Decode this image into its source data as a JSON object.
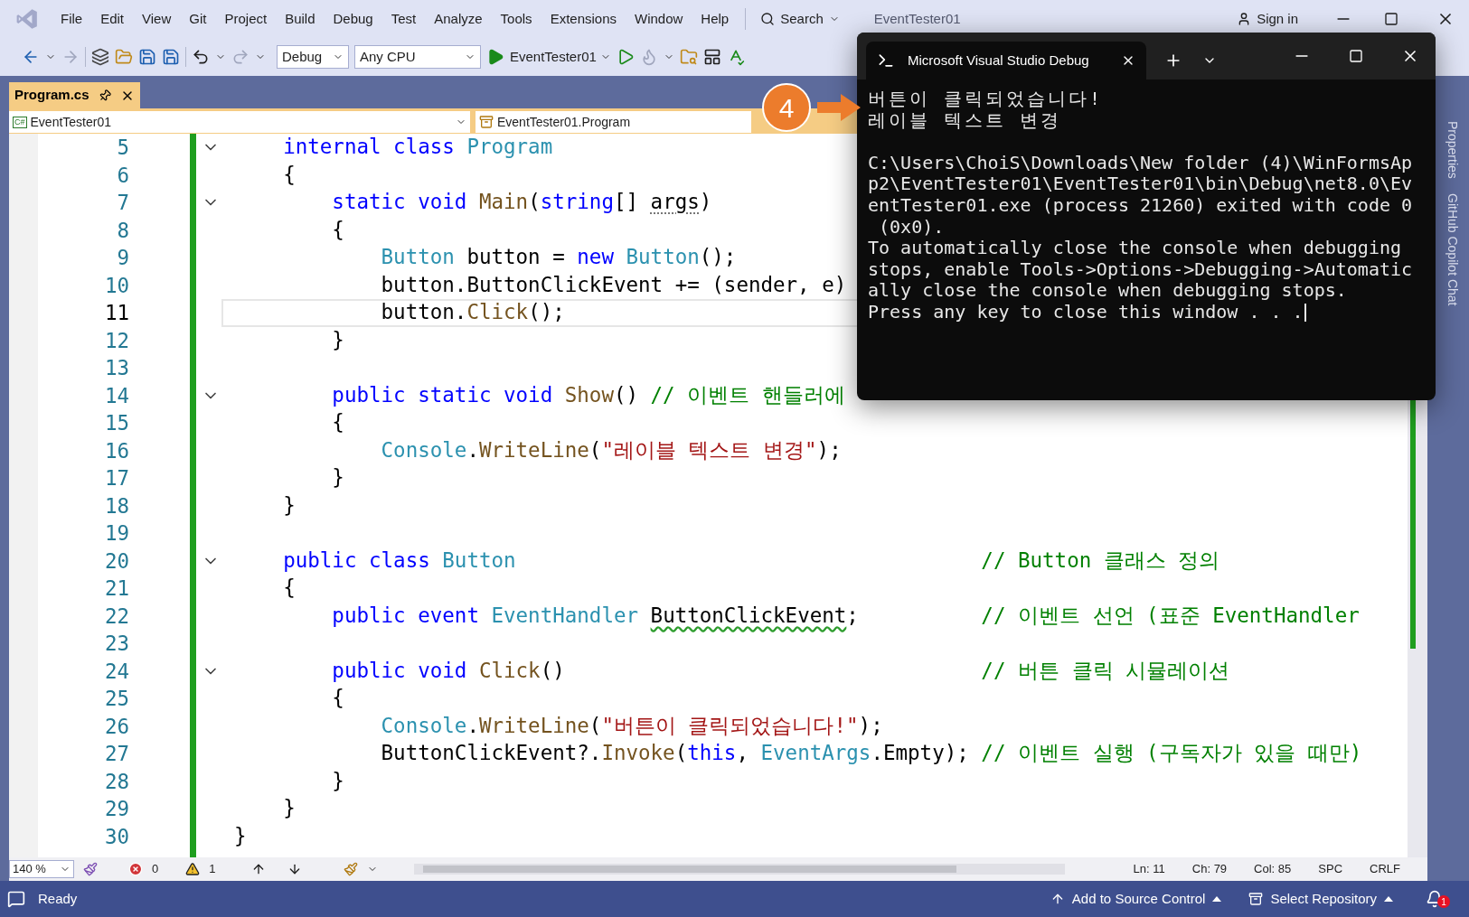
{
  "menu": [
    "File",
    "Edit",
    "View",
    "Git",
    "Project",
    "Build",
    "Debug",
    "Test",
    "Analyze",
    "Tools",
    "Extensions",
    "Window",
    "Help"
  ],
  "search": {
    "label": "Search"
  },
  "window_title": "EventTester01",
  "sign_in": "Sign in",
  "toolbar": {
    "configuration": "Debug",
    "platform": "Any CPU",
    "start_target": "EventTester01"
  },
  "document_tabs": [
    {
      "label": "Program.cs",
      "selected": true
    }
  ],
  "nav_bar": {
    "project_icon": "C#",
    "project": "EventTester01",
    "member": "EventTester01.Program"
  },
  "editor": {
    "lines": [
      {
        "number": "5",
        "foldable": true,
        "selected": false,
        "tokens": [
          {
            "kind": "kw",
            "text": "    internal class "
          },
          {
            "kind": "type",
            "text": "Program"
          }
        ]
      },
      {
        "number": "6",
        "foldable": false,
        "selected": false,
        "tokens": [
          {
            "kind": "plain",
            "text": "    {"
          }
        ]
      },
      {
        "number": "7",
        "foldable": true,
        "selected": false,
        "tokens": [
          {
            "kind": "kw",
            "text": "        static void "
          },
          {
            "kind": "method",
            "text": "Main"
          },
          {
            "kind": "plain",
            "text": "("
          },
          {
            "kind": "kw",
            "text": "string"
          },
          {
            "kind": "plain",
            "text": "[] "
          },
          {
            "kind": "plain",
            "text": "args",
            "dotted": true
          },
          {
            "kind": "plain",
            "text": ")"
          }
        ]
      },
      {
        "number": "8",
        "foldable": false,
        "selected": false,
        "tokens": [
          {
            "kind": "plain",
            "text": "        {"
          }
        ]
      },
      {
        "number": "9",
        "foldable": false,
        "selected": false,
        "tokens": [
          {
            "kind": "type",
            "text": "            Button"
          },
          {
            "kind": "plain",
            "text": " button = "
          },
          {
            "kind": "kw",
            "text": "new "
          },
          {
            "kind": "type",
            "text": "Button"
          },
          {
            "kind": "plain",
            "text": "();"
          }
        ]
      },
      {
        "number": "10",
        "foldable": false,
        "selected": false,
        "tokens": [
          {
            "kind": "plain",
            "text": "            button.ButtonClickEvent += (sender, e)"
          }
        ]
      },
      {
        "number": "11",
        "foldable": false,
        "selected": true,
        "tokens": [
          {
            "kind": "plain",
            "text": "            button."
          },
          {
            "kind": "method",
            "text": "Click"
          },
          {
            "kind": "plain",
            "text": "();"
          }
        ]
      },
      {
        "number": "12",
        "foldable": false,
        "selected": false,
        "tokens": [
          {
            "kind": "plain",
            "text": "        }"
          }
        ]
      },
      {
        "number": "13",
        "foldable": false,
        "selected": false
      },
      {
        "number": "14",
        "foldable": true,
        "selected": false,
        "tokens": [
          {
            "kind": "kw",
            "text": "        public static void "
          },
          {
            "kind": "method",
            "text": "Show"
          },
          {
            "kind": "plain",
            "text": "() "
          },
          {
            "kind": "comment",
            "text": "// 이벤트 핸들러에"
          }
        ]
      },
      {
        "number": "15",
        "foldable": false,
        "selected": false,
        "tokens": [
          {
            "kind": "plain",
            "text": "        {"
          }
        ]
      },
      {
        "number": "16",
        "foldable": false,
        "selected": false,
        "tokens": [
          {
            "kind": "type",
            "text": "            Console"
          },
          {
            "kind": "plain",
            "text": "."
          },
          {
            "kind": "method",
            "text": "WriteLine"
          },
          {
            "kind": "plain",
            "text": "("
          },
          {
            "kind": "string",
            "text": "\"레이블 텍스트 변경\""
          },
          {
            "kind": "plain",
            "text": ");"
          }
        ]
      },
      {
        "number": "17",
        "foldable": false,
        "selected": false,
        "tokens": [
          {
            "kind": "plain",
            "text": "        }"
          }
        ]
      },
      {
        "number": "18",
        "foldable": false,
        "selected": false,
        "tokens": [
          {
            "kind": "plain",
            "text": "    }"
          }
        ]
      },
      {
        "number": "19",
        "foldable": false,
        "selected": false
      },
      {
        "number": "20",
        "foldable": true,
        "selected": false,
        "tokens": [
          {
            "kind": "kw",
            "text": "    public class "
          },
          {
            "kind": "type",
            "text": "Button"
          },
          {
            "kind": "comment",
            "text": "                                      // Button 클래스 정의"
          }
        ]
      },
      {
        "number": "21",
        "foldable": false,
        "selected": false,
        "tokens": [
          {
            "kind": "plain",
            "text": "    {"
          }
        ]
      },
      {
        "number": "22",
        "foldable": false,
        "selected": false,
        "tokens": [
          {
            "kind": "kw",
            "text": "        public event "
          },
          {
            "kind": "type",
            "text": "EventHandler "
          },
          {
            "kind": "plain",
            "text": "ButtonClickEvent",
            "squiggle": true
          },
          {
            "kind": "plain",
            "text": ";"
          },
          {
            "kind": "comment",
            "text": "          // 이벤트 선언 (표준 EventHandler"
          }
        ]
      },
      {
        "number": "23",
        "foldable": false,
        "selected": false
      },
      {
        "number": "24",
        "foldable": true,
        "selected": false,
        "tokens": [
          {
            "kind": "kw",
            "text": "        public void "
          },
          {
            "kind": "method",
            "text": "Click"
          },
          {
            "kind": "plain",
            "text": "()"
          },
          {
            "kind": "comment",
            "text": "                                  // 버튼 클릭 시뮬레이션"
          }
        ]
      },
      {
        "number": "25",
        "foldable": false,
        "selected": false,
        "tokens": [
          {
            "kind": "plain",
            "text": "        {"
          }
        ]
      },
      {
        "number": "26",
        "foldable": false,
        "selected": false,
        "tokens": [
          {
            "kind": "type",
            "text": "            Console"
          },
          {
            "kind": "plain",
            "text": "."
          },
          {
            "kind": "method",
            "text": "WriteLine"
          },
          {
            "kind": "plain",
            "text": "("
          },
          {
            "kind": "string",
            "text": "\"버튼이 클릭되었습니다!\""
          },
          {
            "kind": "plain",
            "text": ");"
          }
        ]
      },
      {
        "number": "27",
        "foldable": false,
        "selected": false,
        "tokens": [
          {
            "kind": "plain",
            "text": "            ButtonClickEvent?."
          },
          {
            "kind": "method",
            "text": "Invoke"
          },
          {
            "kind": "plain",
            "text": "("
          },
          {
            "kind": "kw",
            "text": "this"
          },
          {
            "kind": "plain",
            "text": ", "
          },
          {
            "kind": "type",
            "text": "EventArgs"
          },
          {
            "kind": "plain",
            "text": ".Empty); "
          },
          {
            "kind": "comment",
            "text": "// 이벤트 실행 (구독자가 있을 때만)"
          }
        ]
      },
      {
        "number": "28",
        "foldable": false,
        "selected": false,
        "tokens": [
          {
            "kind": "plain",
            "text": "        }"
          }
        ]
      },
      {
        "number": "29",
        "foldable": false,
        "selected": false,
        "tokens": [
          {
            "kind": "plain",
            "text": "    }"
          }
        ]
      },
      {
        "number": "30",
        "foldable": false,
        "selected": false,
        "tokens": [
          {
            "kind": "plain",
            "text": "}"
          }
        ]
      }
    ]
  },
  "editor_status": {
    "zoom": "140 %",
    "errors": "0",
    "warnings": "1",
    "line": "Ln: 11",
    "char": "Ch: 79",
    "column": "Col: 85",
    "whitespace": "SPC",
    "line_ending": "CRLF"
  },
  "side_tabs": [
    "Properties",
    "GitHub Copilot Chat"
  ],
  "console": {
    "title": "Microsoft Visual Studio Debug",
    "output_lines": [
      "버튼이 클릭되었습니다!",
      "레이블 텍스트 변경"
    ],
    "exit_lines": [
      "C:\\Users\\ChoiS\\Downloads\\New folder (4)\\WinFormsAp",
      "p2\\EventTester01\\EventTester01\\bin\\Debug\\net8.0\\Ev",
      "entTester01.exe (process 21260) exited with code 0",
      " (0x0).",
      "To automatically close the console when debugging",
      "stops, enable Tools->Options->Debugging->Automatic",
      "ally close the console when debugging stops.",
      "Press any key to close this window . . ."
    ]
  },
  "step_badge": "4",
  "status_bar": {
    "state": "Ready",
    "source_control": "Add to Source Control",
    "repository": "Select Repository",
    "notifications": "1"
  }
}
